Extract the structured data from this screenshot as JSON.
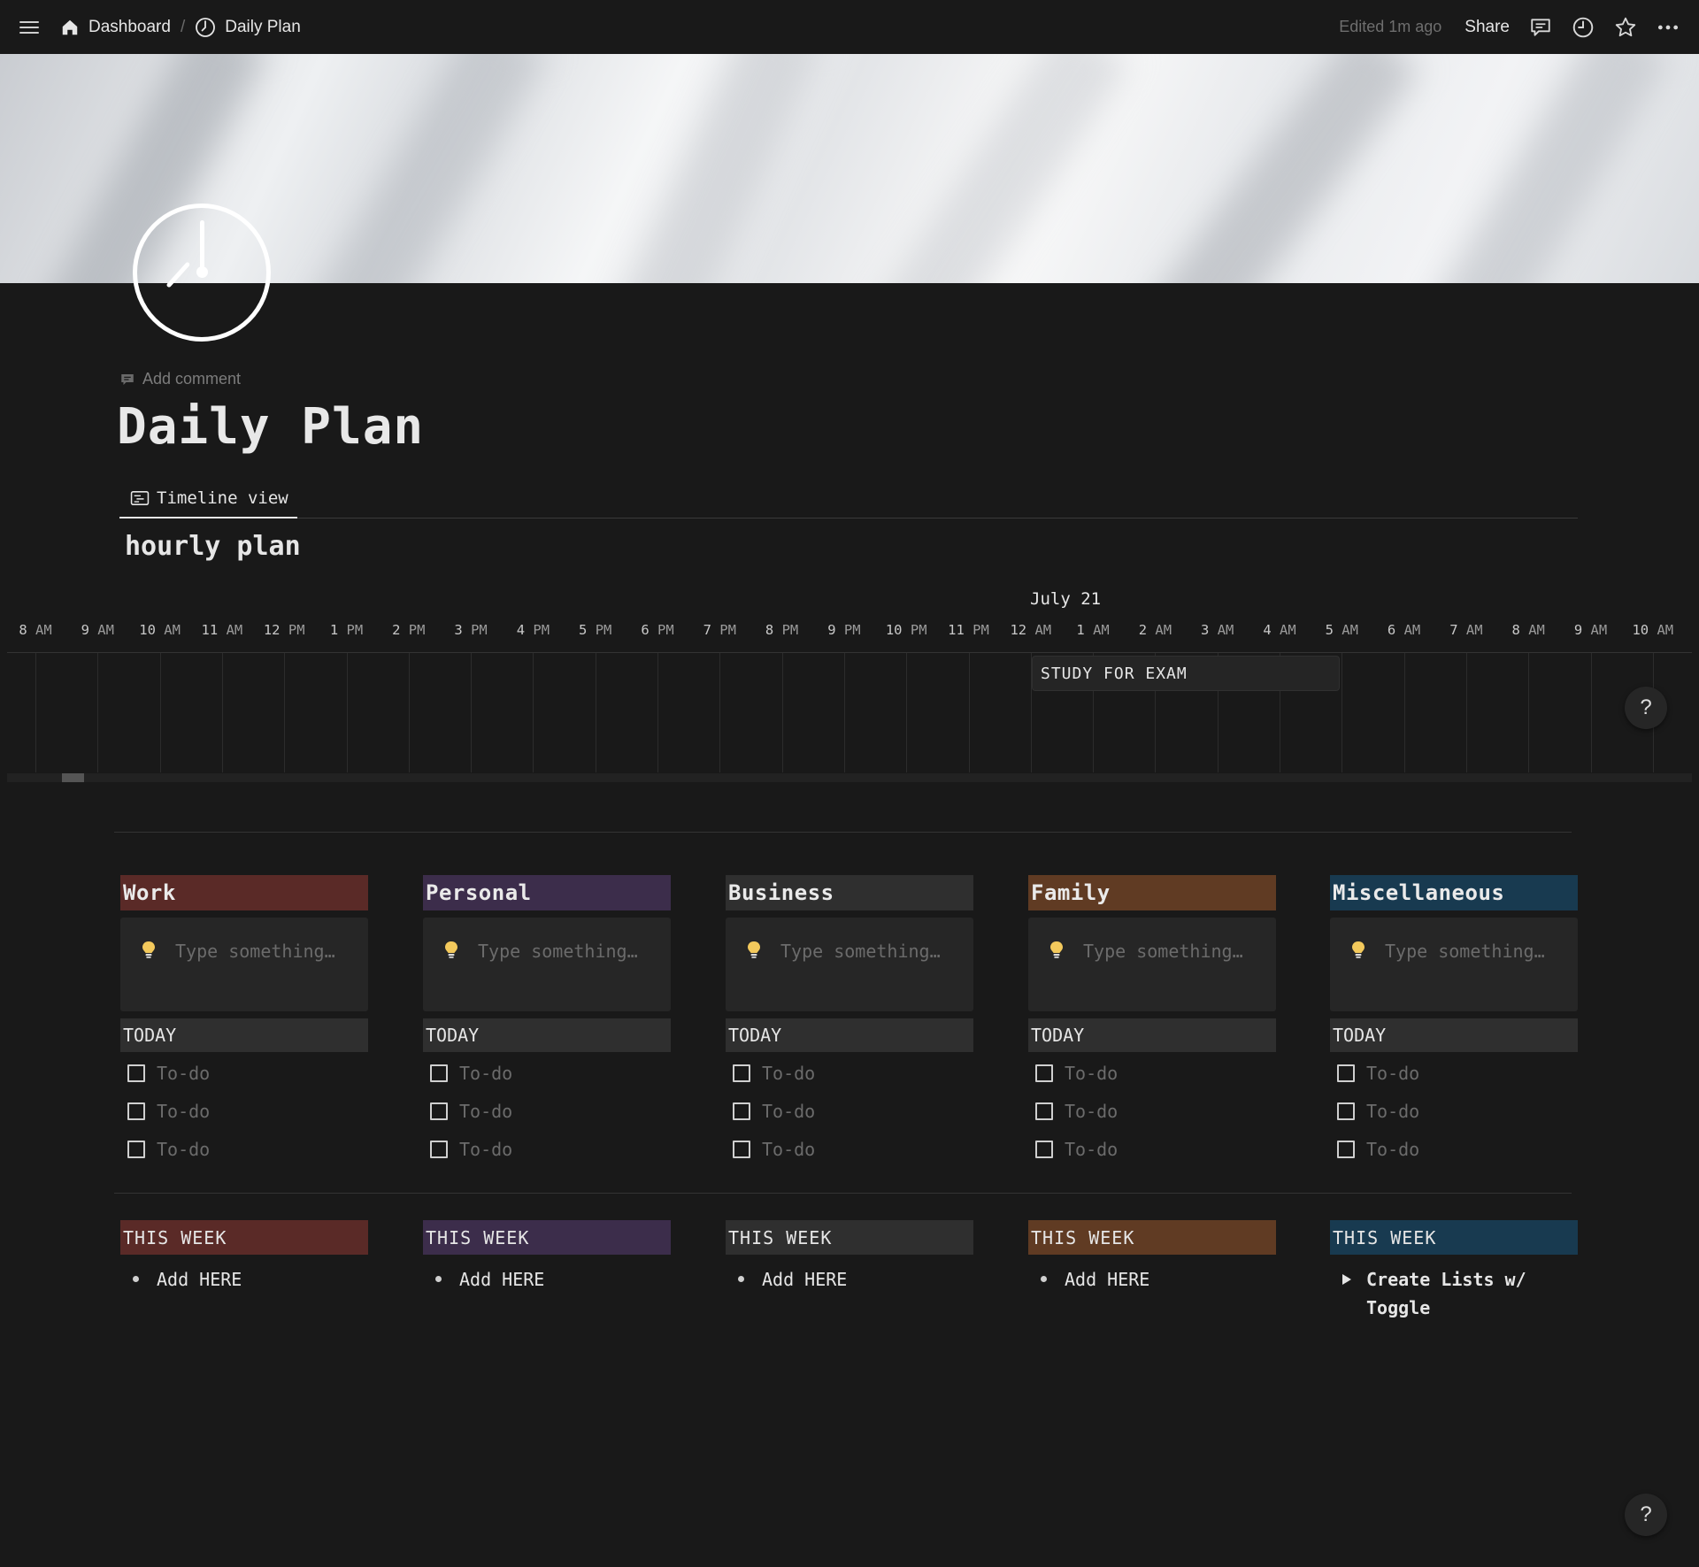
{
  "topbar": {
    "breadcrumb_home": "Dashboard",
    "breadcrumb_sep": "/",
    "breadcrumb_page": "Daily Plan",
    "edited": "Edited 1m ago",
    "share": "Share",
    "icons": [
      "menu-icon",
      "home-icon",
      "clock-icon",
      "comment-icon",
      "history-icon",
      "star-icon",
      "more-icon"
    ]
  },
  "page": {
    "add_comment": "Add comment",
    "title": "Daily Plan",
    "icon": "clock-icon"
  },
  "view": {
    "tab_label": "Timeline view",
    "db_title": "hourly plan"
  },
  "timeline": {
    "month_label": "July 21",
    "hours": [
      {
        "n": "8",
        "s": "AM"
      },
      {
        "n": "9",
        "s": "AM"
      },
      {
        "n": "10",
        "s": "AM"
      },
      {
        "n": "11",
        "s": "AM"
      },
      {
        "n": "12",
        "s": "PM"
      },
      {
        "n": "1",
        "s": "PM"
      },
      {
        "n": "2",
        "s": "PM"
      },
      {
        "n": "3",
        "s": "PM"
      },
      {
        "n": "4",
        "s": "PM"
      },
      {
        "n": "5",
        "s": "PM"
      },
      {
        "n": "6",
        "s": "PM"
      },
      {
        "n": "7",
        "s": "PM"
      },
      {
        "n": "8",
        "s": "PM"
      },
      {
        "n": "9",
        "s": "PM"
      },
      {
        "n": "10",
        "s": "PM"
      },
      {
        "n": "11",
        "s": "PM"
      },
      {
        "n": "12",
        "s": "AM"
      },
      {
        "n": "1",
        "s": "AM"
      },
      {
        "n": "2",
        "s": "AM"
      },
      {
        "n": "3",
        "s": "AM"
      },
      {
        "n": "4",
        "s": "AM"
      },
      {
        "n": "5",
        "s": "AM"
      },
      {
        "n": "6",
        "s": "AM"
      },
      {
        "n": "7",
        "s": "AM"
      },
      {
        "n": "8",
        "s": "AM"
      },
      {
        "n": "9",
        "s": "AM"
      },
      {
        "n": "10",
        "s": "AM"
      }
    ],
    "event": "STUDY FOR EXAM"
  },
  "help": "?",
  "columns": [
    {
      "name": "Work",
      "color": "#5a2a27",
      "placeholder": "Type something…",
      "today": "TODAY",
      "todos": [
        "To-do",
        "To-do",
        "To-do"
      ],
      "week": "THIS WEEK",
      "week_item": "Add HERE",
      "week_item_type": "bullet"
    },
    {
      "name": "Personal",
      "color": "#3c2d4b",
      "placeholder": "Type something…",
      "today": "TODAY",
      "todos": [
        "To-do",
        "To-do",
        "To-do"
      ],
      "week": "THIS WEEK",
      "week_item": "Add HERE",
      "week_item_type": "bullet"
    },
    {
      "name": "Business",
      "color": "#2f2f2f",
      "placeholder": "Type something…",
      "today": "TODAY",
      "todos": [
        "To-do",
        "To-do",
        "To-do"
      ],
      "week": "THIS WEEK",
      "week_item": "Add HERE",
      "week_item_type": "bullet"
    },
    {
      "name": "Family",
      "color": "#603b23",
      "placeholder": "Type something…",
      "today": "TODAY",
      "todos": [
        "To-do",
        "To-do",
        "To-do"
      ],
      "week": "THIS WEEK",
      "week_item": "Add HERE",
      "week_item_type": "bullet"
    },
    {
      "name": "Miscellaneous",
      "color": "#183a50",
      "placeholder": "Type something…",
      "today": "TODAY",
      "todos": [
        "To-do",
        "To-do",
        "To-do"
      ],
      "week": "THIS WEEK",
      "week_item": "Create Lists w/ Toggle",
      "week_item_type": "toggle"
    }
  ]
}
